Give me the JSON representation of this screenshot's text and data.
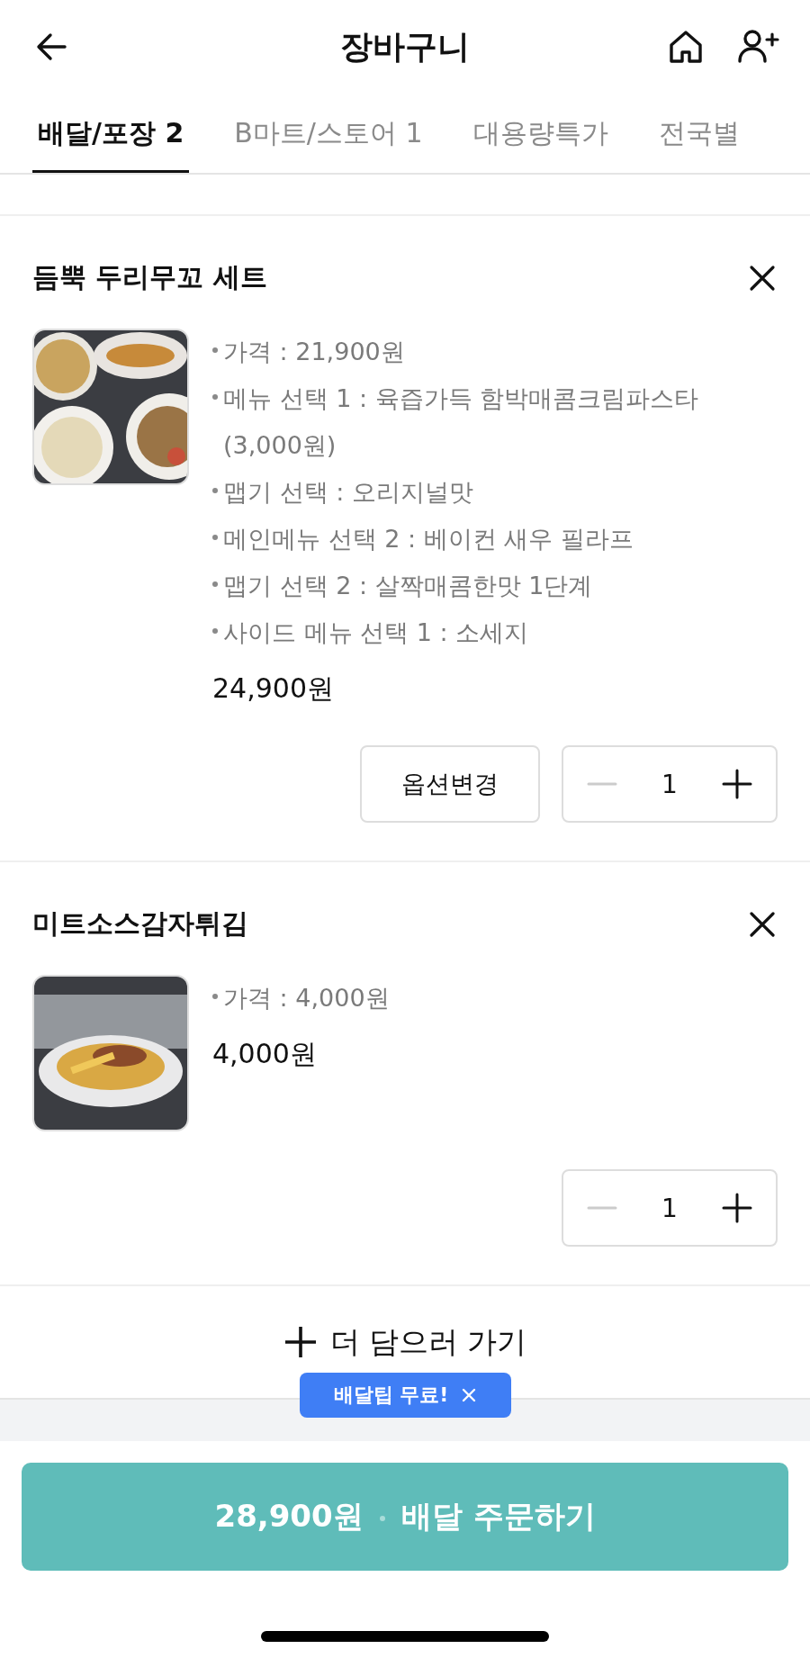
{
  "header": {
    "title": "장바구니"
  },
  "tabs": [
    {
      "label": "배달/포장 2",
      "selected": true
    },
    {
      "label": "B마트/스토어 1",
      "selected": false
    },
    {
      "label": "대용량특가",
      "selected": false
    },
    {
      "label": "전국별",
      "selected": false
    }
  ],
  "items": [
    {
      "name": "듬뿍 두리무꼬 세트",
      "image": {
        "kind": "picture"
      },
      "options": [
        "가격 : 21,900원",
        "메뉴 선택 1 : 육즙가득 함박매콤크림파스타 (3,000원)",
        "맵기 선택 : 오리지널맛",
        "메인메뉴 선택 2 : 베이컨 새우 필라프",
        "맵기 선택 2 : 살짝매콤한맛 1단계",
        "사이드 메뉴 선택 1 : 소세지"
      ],
      "price": "24,900원",
      "option_button": "옵션변경",
      "quantity": "1"
    },
    {
      "name": "미트소스감자튀김",
      "image": {
        "kind": "picture"
      },
      "options": [
        "가격 : 4,000원"
      ],
      "price": "4,000원",
      "quantity": "1"
    }
  ],
  "add_more": "더 담으러 가기",
  "tooltip": "배달팁 무료!",
  "order_button": {
    "amount": "28,900원",
    "label": "배달 주문하기"
  }
}
